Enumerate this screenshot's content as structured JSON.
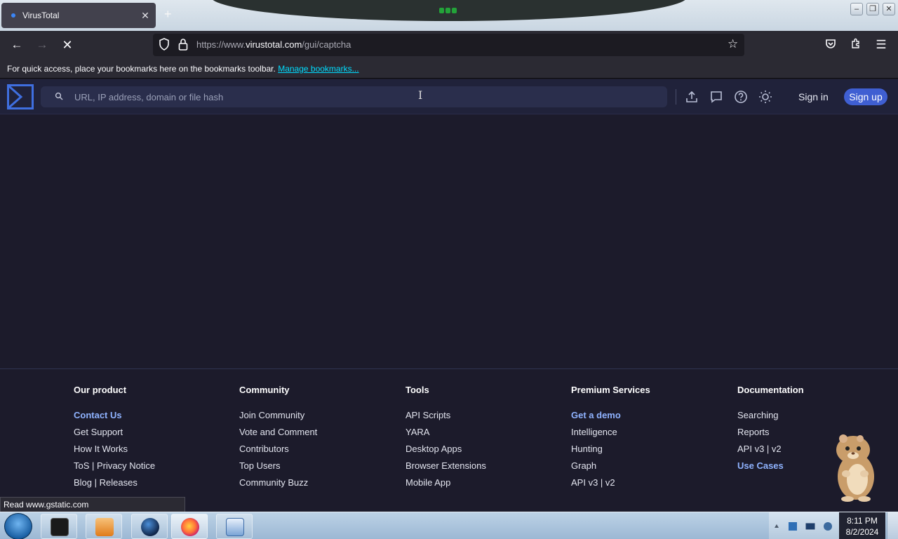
{
  "browser": {
    "tab_title": "VirusTotal",
    "new_tab": "+",
    "tab_close": "✕",
    "url_prefix": "https://www.",
    "url_host": "virustotal.com",
    "url_path": "/gui/captcha",
    "bookmarks_text": "For quick access, place your bookmarks here on the bookmarks toolbar.",
    "bookmarks_link": "Manage bookmarks...",
    "status_text": "Read www.gstatic.com"
  },
  "vt": {
    "search_placeholder": "URL, IP address, domain or file hash",
    "sign_in": "Sign in",
    "sign_up": "Sign up",
    "icons": [
      "upload-icon",
      "chat-icon",
      "help-icon",
      "theme-icon"
    ]
  },
  "footer": {
    "columns": [
      {
        "heading": "Our product",
        "links": [
          "Contact Us",
          "Get Support",
          "How It Works",
          "ToS | Privacy Notice",
          "Blog | Releases"
        ]
      },
      {
        "heading": "Community",
        "links": [
          "Join Community",
          "Vote and Comment",
          "Contributors",
          "Top Users",
          "Community Buzz"
        ]
      },
      {
        "heading": "Tools",
        "links": [
          "API Scripts",
          "YARA",
          "Desktop Apps",
          "Browser Extensions",
          "Mobile App"
        ]
      },
      {
        "heading": "Premium Services",
        "links": [
          "Get a demo",
          "Intelligence",
          "Hunting",
          "Graph",
          "API v3 | v2"
        ]
      },
      {
        "heading": "Documentation",
        "links": [
          "Searching",
          "Reports",
          "API v3 | v2",
          "Use Cases"
        ]
      }
    ]
  },
  "taskbar": {
    "time": "8:11 PM",
    "date": "8/2/2024"
  },
  "colors": {
    "vt_header": "#20223a",
    "page_bg": "#1c1b2b",
    "accent_link": "#8fb3ff",
    "signup_bg": "#3f5fd2"
  }
}
